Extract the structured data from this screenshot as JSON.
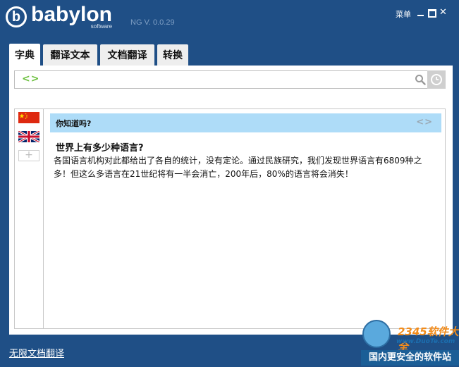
{
  "app": {
    "logo_text": "babylon",
    "logo_subtext": "software",
    "version": "NG V. 0.0.29",
    "menu_label": "菜单",
    "window_controls": {
      "minimize_icon": "minimize-icon",
      "maximize_icon": "maximize-icon",
      "close_icon": "close-icon",
      "close_glyph": "✕"
    }
  },
  "tabs": [
    {
      "label": "字典",
      "active": true
    },
    {
      "label": "翻译文本",
      "active": false
    },
    {
      "label": "文档翻译",
      "active": false
    },
    {
      "label": "转换",
      "active": false
    }
  ],
  "search": {
    "toggle_glyph": "<>",
    "value": "",
    "placeholder": "",
    "search_icon": "search-icon",
    "history_icon": "clock-icon"
  },
  "languages": {
    "items": [
      {
        "name": "china-flag",
        "icon": "cn-flag-icon"
      },
      {
        "name": "uk-flag",
        "icon": "uk-flag-icon"
      }
    ],
    "add_glyph": "+"
  },
  "did_you_know": {
    "title": "你知道吗?",
    "nav_glyph": "<>"
  },
  "article": {
    "title": "世界上有多少种语言?",
    "body": "各国语言机构对此都给出了各自的统计，没有定论。通过民族研究，我们发现世界语言有6809种之多！但这么多语言在21世纪将有一半会消亡，200年后，80%的语言将会消失！"
  },
  "footer": {
    "link_label": "无限文档翻译"
  },
  "watermark": {
    "top_text": "2345软件大全",
    "url_text": "www.DuoTe.com",
    "bottom_text": "国内更安全的软件站"
  },
  "colors": {
    "background": "#1f4f86",
    "panel": "#ffffff",
    "info_bar": "#aedcf8",
    "accent_green": "#6abf3c"
  }
}
